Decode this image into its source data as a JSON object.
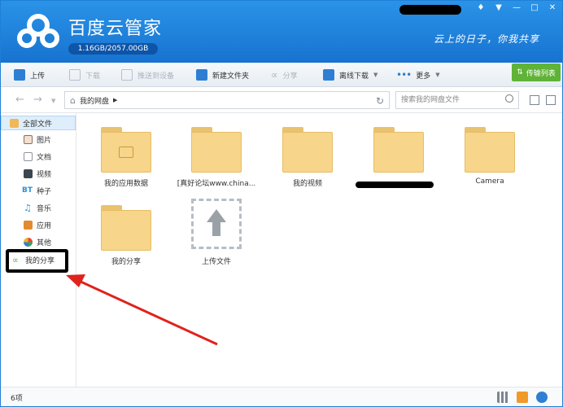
{
  "header": {
    "app_title": "百度云管家",
    "quota": "1.16GB/2057.00GB",
    "slogan": "云上的日子，你我共享",
    "window_controls": [
      "bell-icon",
      "chevron-down-icon",
      "minimize-icon",
      "maximize-icon",
      "close-icon"
    ]
  },
  "toolbar": {
    "upload": "上传",
    "download": "下载",
    "push_device": "推送到设备",
    "new_folder": "新建文件夹",
    "share": "分享",
    "offline_download": "离线下载",
    "more": "更多",
    "transfer_list": "传输列表"
  },
  "navbar": {
    "path": "我的网盘",
    "search_placeholder": "搜索我的网盘文件"
  },
  "sidebar": {
    "items": [
      {
        "label": "全部文件",
        "icon": "folder-icon"
      },
      {
        "label": "图片",
        "icon": "image-icon"
      },
      {
        "label": "文档",
        "icon": "document-icon"
      },
      {
        "label": "视频",
        "icon": "video-icon"
      },
      {
        "label": "种子",
        "icon": "torrent-icon",
        "badge": "BT"
      },
      {
        "label": "音乐",
        "icon": "music-icon"
      },
      {
        "label": "应用",
        "icon": "app-icon"
      },
      {
        "label": "其他",
        "icon": "other-icon"
      },
      {
        "label": "我的分享",
        "icon": "share-icon"
      }
    ]
  },
  "files": [
    {
      "name": "我的应用数据",
      "type": "app-folder"
    },
    {
      "name": "[真好论坛www.china...",
      "type": "folder"
    },
    {
      "name": "我的视频",
      "type": "folder"
    },
    {
      "name": "",
      "type": "folder"
    },
    {
      "name": "Camera",
      "type": "folder"
    },
    {
      "name": "我的分享",
      "type": "folder"
    },
    {
      "name": "上传文件",
      "type": "upload"
    }
  ],
  "status": {
    "count": "6项"
  },
  "colors": {
    "header_blue": "#1f7fd6",
    "transfer_green": "#5fb336",
    "folder_yellow": "#f7d58a",
    "annotation_red": "#e0221c"
  }
}
